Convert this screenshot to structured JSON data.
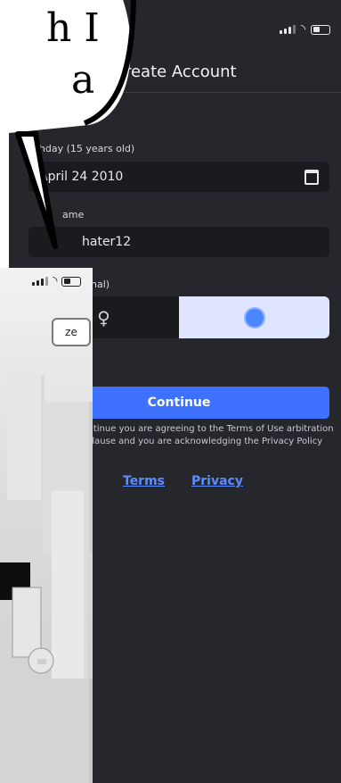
{
  "signup": {
    "title": "Create Account",
    "birthday_label": "irthday (15 years old)",
    "birthday_value": "April 24 2010",
    "username_label": "ame",
    "username_value": "hater12",
    "gender_label": "nal)",
    "continue_label": "Continue",
    "legal_text": "Continue you are agreeing to the Terms of Use arbitration clause and you are acknowledging the Privacy Policy",
    "terms_link": "Terms",
    "privacy_link": "Privacy"
  },
  "game": {
    "resize_chip": "ze"
  },
  "bubble": {
    "line1": "h I",
    "line2": "a"
  },
  "colors": {
    "background": "#25272d",
    "field": "#1a1b1f",
    "accent": "#3e71ff",
    "link": "#5d8cff",
    "selected_segment": "#e0e6ff"
  },
  "icons": {
    "calendar": "calendar-icon",
    "male": "male-icon",
    "female": "female-icon",
    "signal": "signal-icon",
    "wifi": "wifi-icon",
    "battery": "battery-icon"
  }
}
